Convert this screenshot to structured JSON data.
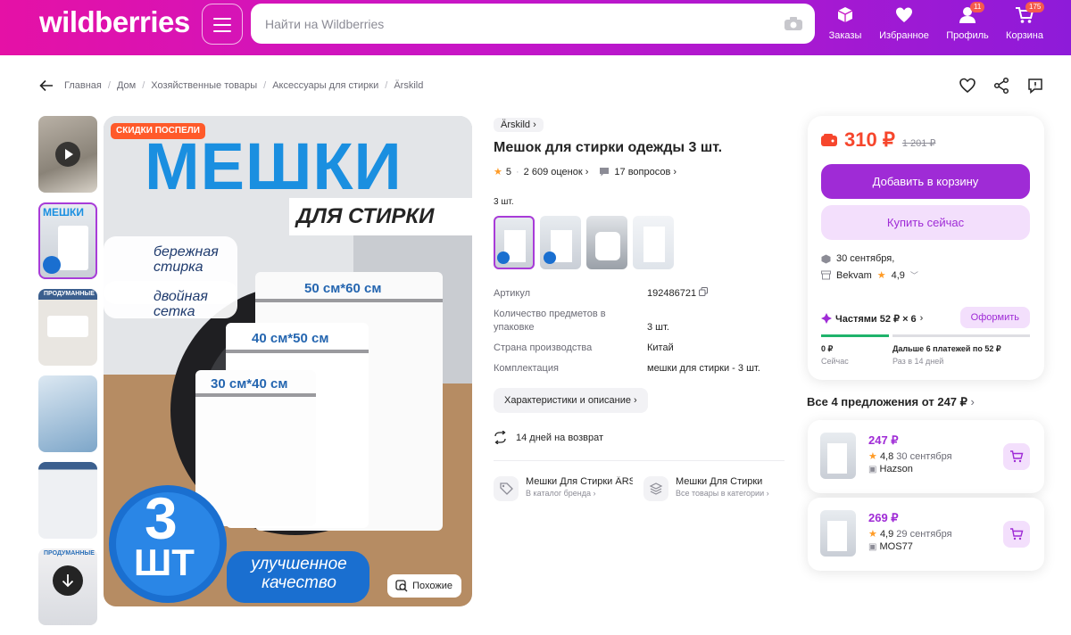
{
  "header": {
    "logo": "wildberries",
    "search_placeholder": "Найти на Wildberries",
    "nav": [
      {
        "label": "Заказы",
        "icon": "box-icon"
      },
      {
        "label": "Избранное",
        "icon": "heart-icon"
      },
      {
        "label": "Профиль",
        "icon": "user-icon",
        "badge": "11"
      },
      {
        "label": "Корзина",
        "icon": "cart-icon",
        "badge": "175"
      }
    ]
  },
  "breadcrumbs": [
    "Главная",
    "Дом",
    "Хозяйственные товары",
    "Аксессуары для стирки",
    "Ärskild"
  ],
  "gallery": {
    "badge": "СКИДКИ ПОСПЕЛИ",
    "headline": "МЕШКИ",
    "subheadline": "ДЛЯ СТИРКИ",
    "feature1": "бережная стирка",
    "feature2": "двойная сетка",
    "size1": "50 см*60 см",
    "size2": "40 см*50 см",
    "size3": "30 см*40 см",
    "count_num": "3",
    "count_unit": "ШТ",
    "quality": "улучшенное качество",
    "similar_button": "Похожие",
    "thumb_labels": [
      "МЕШКИ",
      "ПРОДУМАННЫЕ",
      "ПРОДУМАННЫЕ"
    ]
  },
  "product": {
    "brand": "Ärskild",
    "title": "Мешок для стирки одежды 3 шт.",
    "rating": "5",
    "reviews": "2 609 оценок",
    "questions": "17 вопросов",
    "variant_label": "3 шт.",
    "specs": [
      {
        "key": "Артикул",
        "value": "192486721"
      },
      {
        "key": "Количество предметов в упаковке",
        "value": "3 шт."
      },
      {
        "key": "Страна производства",
        "value": "Китай"
      },
      {
        "key": "Комплектация",
        "value": "мешки для стирки - 3 шт."
      }
    ],
    "chars_button": "Характеристики и описание",
    "returns": "14 дней на возврат",
    "link_brand_title": "Мешки Для Стирки ÄRSKILD",
    "link_brand_sub": "В каталог бренда",
    "link_cat_title": "Мешки Для Стирки",
    "link_cat_sub": "Все товары в категории"
  },
  "buybox": {
    "price": "310 ₽",
    "old_price": "1 201 ₽",
    "add_to_cart": "Добавить в корзину",
    "buy_now": "Купить сейчас",
    "delivery_date": "30 сентября,",
    "seller": "Bekvam",
    "seller_rating": "4,9",
    "installments": "Частями 52 ₽ × 6",
    "checkout": "Оформить",
    "pay_now_amount": "0 ₽",
    "pay_now_label": "Сейчас",
    "pay_later_amount": "Дальше 6 платежей по 52 ₽",
    "pay_later_label": "Раз в 14 дней"
  },
  "offers": {
    "title": "Все 4 предложения от 247 ₽",
    "items": [
      {
        "price": "247 ₽",
        "rating": "4,8",
        "date": "30 сентября",
        "seller": "Hazson"
      },
      {
        "price": "269 ₽",
        "rating": "4,9",
        "date": "29 сентября",
        "seller": "MOS77"
      }
    ]
  },
  "colors": {
    "brand_gradient_start": "#e511a6",
    "brand_gradient_end": "#8e1bd9",
    "accent": "#9f2bd6",
    "price": "#f6462c",
    "headline_blue": "#1a8fe0"
  }
}
